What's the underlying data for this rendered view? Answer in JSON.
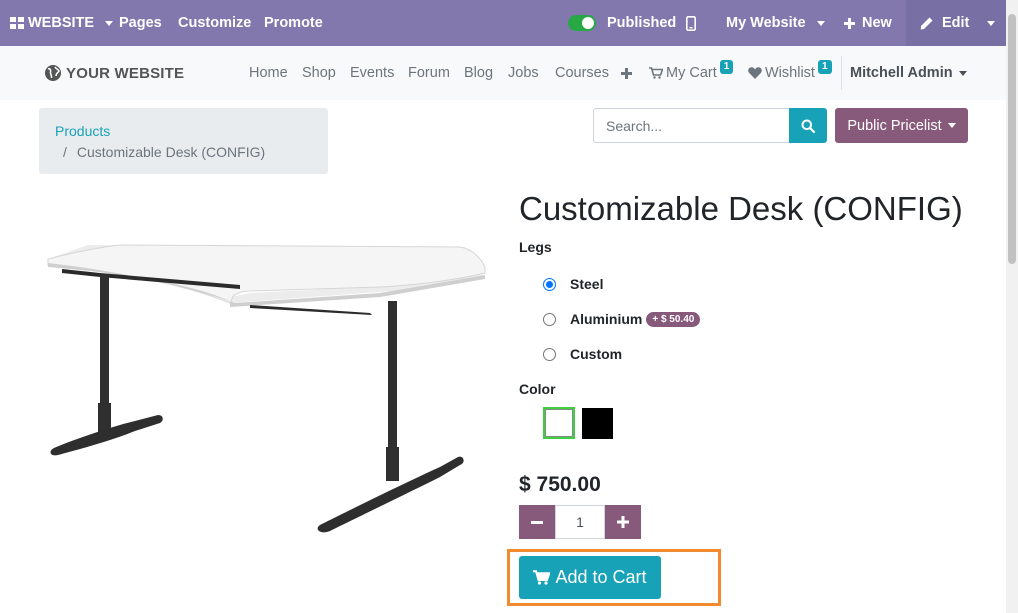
{
  "adminbar": {
    "website_menu": "WEBSITE",
    "pages": "Pages",
    "customize": "Customize",
    "promote": "Promote",
    "published": "Published",
    "my_website": "My Website",
    "new": "New",
    "edit": "Edit"
  },
  "navbar": {
    "logo": "YOUR WEBSITE",
    "links": [
      "Home",
      "Shop",
      "Events",
      "Forum",
      "Blog",
      "Jobs",
      "Courses"
    ],
    "cart_label": "My Cart",
    "cart_count": "1",
    "wishlist_label": "Wishlist",
    "wishlist_count": "1",
    "user": "Mitchell Admin"
  },
  "breadcrumb": {
    "parent": "Products",
    "separator": "/",
    "current": "Customizable Desk (CONFIG)"
  },
  "search": {
    "placeholder": "Search..."
  },
  "pricelist": {
    "label": "Public Pricelist"
  },
  "product": {
    "title": "Customizable Desk (CONFIG)",
    "legs_label": "Legs",
    "legs_options": [
      {
        "label": "Steel",
        "selected": true
      },
      {
        "label": "Aluminium",
        "extra": "+ $ 50.40",
        "selected": false
      },
      {
        "label": "Custom",
        "selected": false
      }
    ],
    "color_label": "Color",
    "colors": [
      {
        "value": "#ffffff",
        "selected": true
      },
      {
        "value": "#000000",
        "selected": false
      }
    ],
    "price": "$ 750.00",
    "quantity": "1",
    "add_to_cart": "Add to Cart"
  },
  "colors": {
    "admin_bar": "#8278ae",
    "accent_teal": "#17a2b8",
    "primary_purple": "#875a7b",
    "highlight_orange": "#f28a30"
  }
}
